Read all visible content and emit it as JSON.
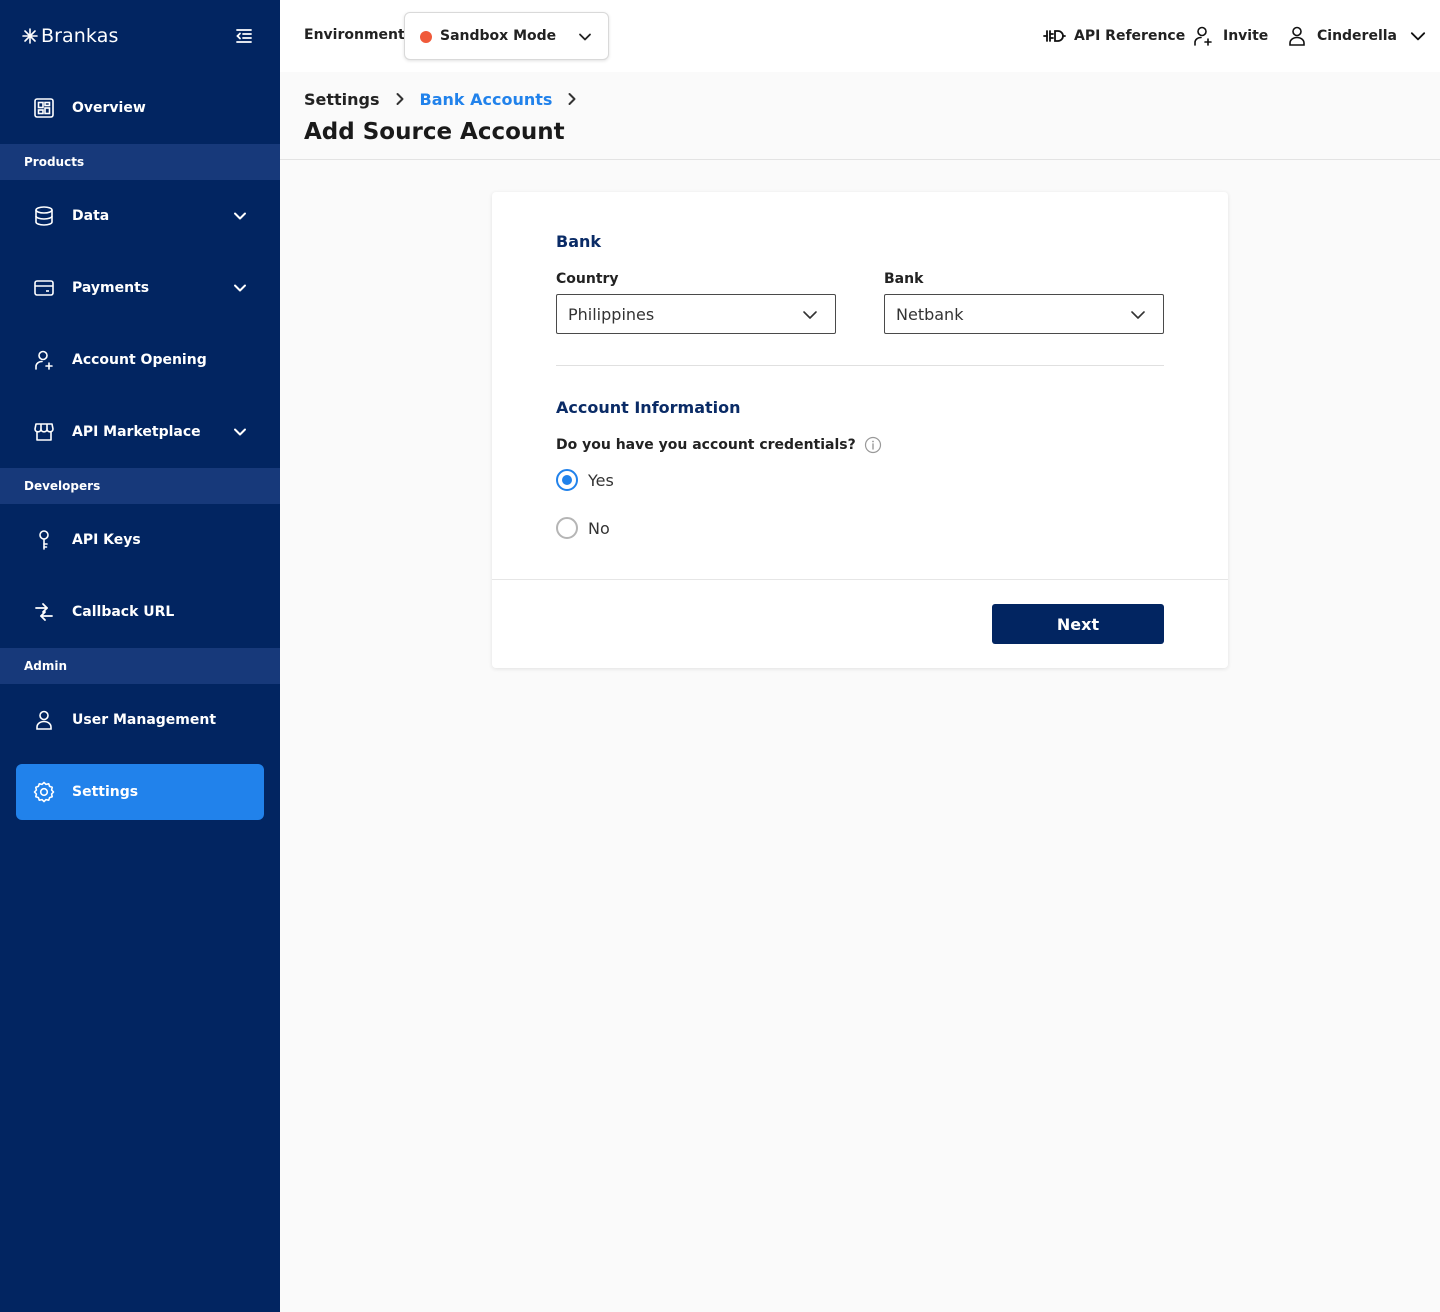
{
  "brand": {
    "name": "Brankas"
  },
  "sidebar": {
    "overview": "Overview",
    "sections": {
      "products": "Products",
      "developers": "Developers",
      "admin": "Admin"
    },
    "items": {
      "data": "Data",
      "payments": "Payments",
      "account_opening": "Account Opening",
      "api_marketplace": "API Marketplace",
      "api_keys": "API Keys",
      "callback_url": "Callback URL",
      "user_management": "User Management",
      "settings": "Settings"
    }
  },
  "topbar": {
    "environment_label": "Environment:",
    "environment_value": "Sandbox Mode",
    "api_reference": "API Reference",
    "invite": "Invite",
    "user_name": "Cinderella"
  },
  "breadcrumb": {
    "root": "Settings",
    "current": "Bank Accounts"
  },
  "page": {
    "title": "Add Source Account"
  },
  "form": {
    "bank_section": "Bank",
    "country_label": "Country",
    "country_value": "Philippines",
    "bank_label": "Bank",
    "bank_value": "Netbank",
    "account_section": "Account Information",
    "question": "Do you have you account credentials?",
    "options": [
      {
        "label": "Yes",
        "selected": true
      },
      {
        "label": "No",
        "selected": false
      }
    ],
    "next_label": "Next"
  },
  "colors": {
    "sidebar": "#022561",
    "accent": "#2182eb",
    "section_header": "#17397a",
    "env_dot": "#f05a3a"
  }
}
